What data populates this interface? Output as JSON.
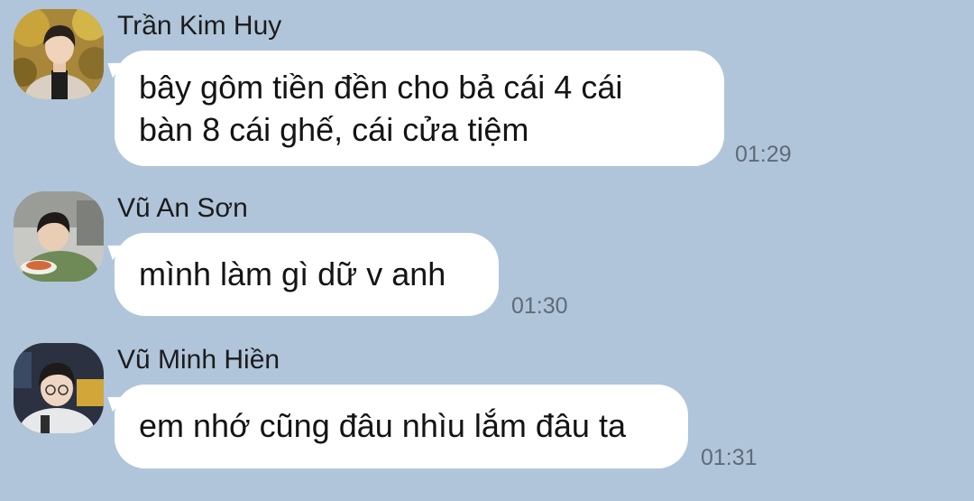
{
  "messages": [
    {
      "sender": "Trần Kim Huy",
      "lines": [
        "bây gôm tiền đền cho bả cái 4 cái",
        "bàn 8 cái ghế, cái cửa tiệm"
      ],
      "time": "01:29"
    },
    {
      "sender": "Vũ An Sơn",
      "lines": [
        "mình làm gì dữ v anh"
      ],
      "time": "01:30"
    },
    {
      "sender": "Vũ Minh Hiền",
      "lines": [
        "em nhớ cũng đâu nhìu lắm đâu ta"
      ],
      "time": "01:31"
    }
  ],
  "colors": {
    "background": "#b0c5da",
    "bubble": "#ffffff",
    "timestamp": "#5f6b78"
  }
}
